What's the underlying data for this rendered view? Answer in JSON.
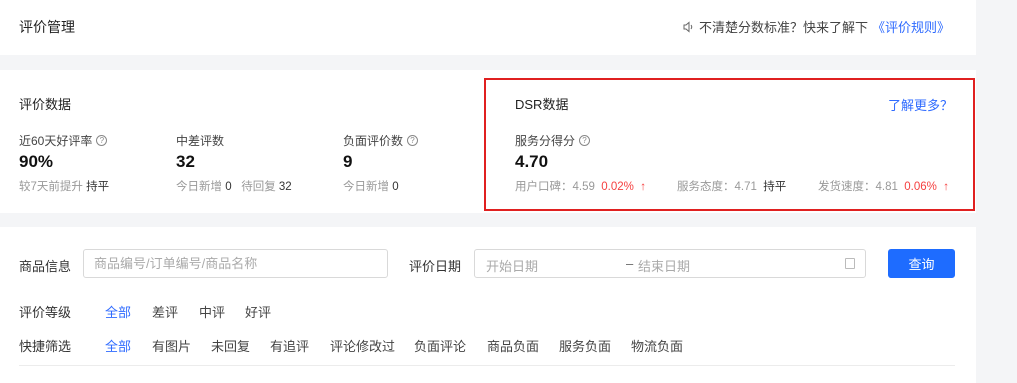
{
  "header": {
    "title": "评价管理",
    "notice_text": "不清楚分数标准？快来了解下",
    "notice_link": "《评价规则》"
  },
  "review_data": {
    "title": "评价数据",
    "metrics": [
      {
        "label": "近60天好评率",
        "value": "90%",
        "sub_label": "较7天前提升",
        "sub_value": "持平"
      },
      {
        "label": "中差评数",
        "value": "32",
        "sub_label": "今日新增",
        "sub_value": "0",
        "sub_label2": "待回复",
        "sub_value2": "32"
      },
      {
        "label": "负面评价数",
        "value": "9",
        "sub_label": "今日新增",
        "sub_value": "0"
      }
    ]
  },
  "dsr": {
    "title": "DSR数据",
    "learn_more": "了解更多？",
    "score_label": "服务分得分",
    "score_value": "4.70",
    "items": [
      {
        "label": "用户口碑：",
        "value": "4.59",
        "change": "0.02%",
        "trend": "up"
      },
      {
        "label": "服务态度：",
        "value": "4.71",
        "change": "持平",
        "trend": "flat"
      },
      {
        "label": "发货速度：",
        "value": "4.81",
        "change": "0.06%",
        "trend": "up"
      }
    ]
  },
  "filters": {
    "product_label": "商品信息",
    "product_placeholder": "商品编号/订单编号/商品名称",
    "date_label": "评价日期",
    "date_start_placeholder": "开始日期",
    "date_separator": "–",
    "date_end_placeholder": "结束日期",
    "query_button": "查询",
    "rating_label": "评价等级",
    "rating_options": [
      "全部",
      "差评",
      "中评",
      "好评"
    ],
    "quick_label": "快捷筛选",
    "quick_options": [
      "全部",
      "有图片",
      "未回复",
      "有追评",
      "评论修改过",
      "负面评论",
      "商品负面",
      "服务负面",
      "物流负面"
    ]
  },
  "colors": {
    "accent": "#2f6bff",
    "primary_button": "#1e6cff",
    "highlight_border": "#e02020",
    "increase": "#f53f3f"
  }
}
